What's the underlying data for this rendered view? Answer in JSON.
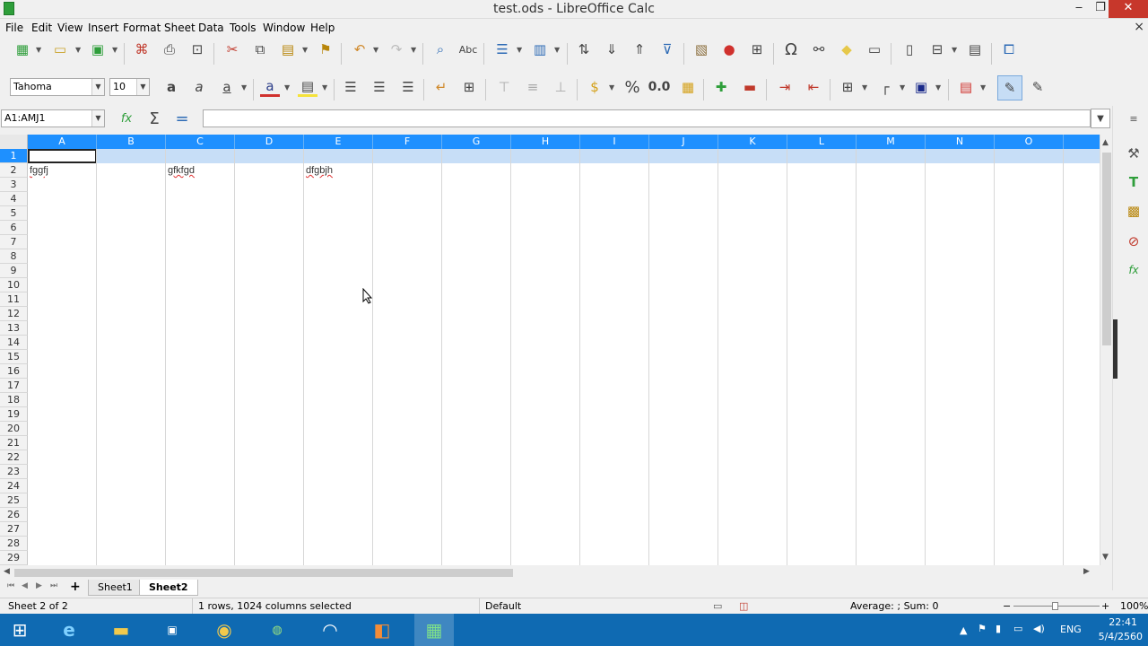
{
  "window": {
    "title": "test.ods - LibreOffice Calc",
    "minimize": "‒",
    "maximize": "❐",
    "close": "✕",
    "doc_close": "×"
  },
  "menu": [
    "File",
    "Edit",
    "View",
    "Insert",
    "Format",
    "Sheet",
    "Data",
    "Tools",
    "Window",
    "Help"
  ],
  "formatting": {
    "font_name": "Tahoma",
    "font_size": "10"
  },
  "formula_bar": {
    "name_box": "A1:AMJ1",
    "formula": "",
    "number_format_pct": "%",
    "number_format_dec": "0.0"
  },
  "columns": [
    "A",
    "B",
    "C",
    "D",
    "E",
    "F",
    "G",
    "H",
    "I",
    "J",
    "K",
    "L",
    "M",
    "N",
    "O"
  ],
  "rows": [
    "1",
    "2",
    "3",
    "4",
    "5",
    "6",
    "7",
    "8",
    "9",
    "10",
    "11",
    "12",
    "13",
    "14",
    "15",
    "16",
    "17",
    "18",
    "19",
    "20",
    "21",
    "22",
    "23",
    "24",
    "25",
    "26",
    "27",
    "28",
    "29"
  ],
  "cells": {
    "A2": "fggfj",
    "C2": "gfkfgd",
    "E2": "dfgbjh"
  },
  "sheets": {
    "add": "+",
    "tabs": [
      "Sheet1",
      "Sheet2"
    ],
    "active": "Sheet2"
  },
  "status": {
    "sheet_info": "Sheet 2 of 2",
    "selection": "1 rows, 1024 columns selected",
    "page_style": "Default",
    "aggregate": "Average: ; Sum: 0",
    "zoom": "100%"
  },
  "taskbar": {
    "time": "22:41",
    "date": "5/4/2560",
    "lang": "ENG"
  }
}
